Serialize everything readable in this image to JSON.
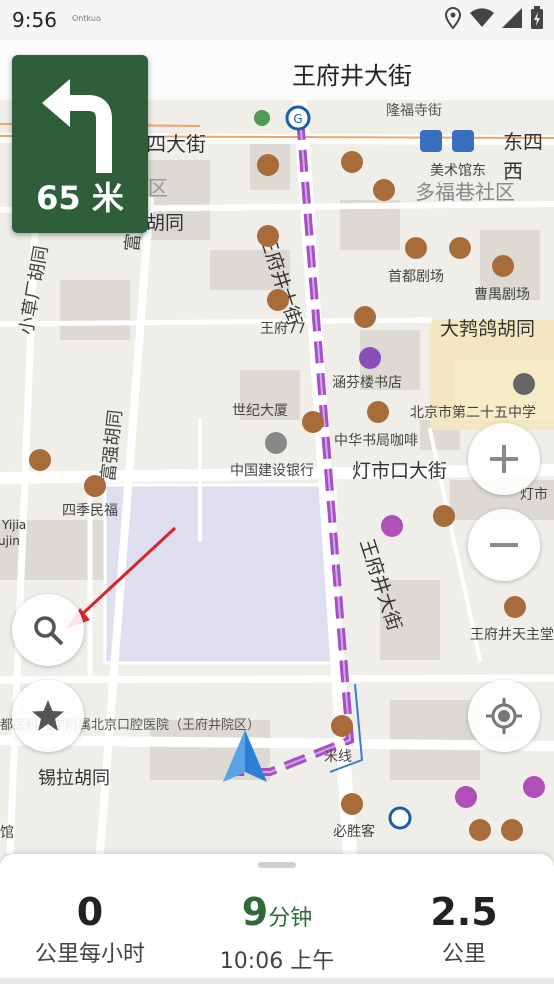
{
  "status_bar": {
    "time": "9:56",
    "tiny_label": "Ontkuo"
  },
  "header": {
    "current_street": "王府井大街"
  },
  "maneuver": {
    "distance": "65 米"
  },
  "map": {
    "streets": {
      "dongsi_west": "四大街",
      "dongsi_east": "东四西",
      "wangfujing_north": "王府井大街",
      "wangfujing_south": "王府井大街",
      "dengshikou": "灯市口大街",
      "fuqiang": "富强胡同",
      "fuqiang2": "富强胡同",
      "xiaoqiao": "小草厂胡同",
      "hutong": "胡同",
      "xila": "锡拉胡同",
      "dapu": "大鹁鸽胡同",
      "district": "区",
      "duofu": "多福巷社区",
      "yijia": "Yijia",
      "jin": "ujin"
    },
    "pois": {
      "longfu": "隆福寺街",
      "meishu": "美术馆东",
      "shoudu": "首都剧场",
      "caoyu": "曹禺剧场",
      "wangfu77": "王府77",
      "hanfen": "涵芬楼书店",
      "zhonghua": "中华书局咖啡",
      "shijida": "世纪大厦",
      "jianshe": "中国建设银行",
      "sijimin": "四季民福",
      "school25": "北京市第二十五中学",
      "church": "王府井天主堂",
      "hospital": "都医科大学附属北京口腔医院（王府井院区）",
      "mixian": "米线",
      "bisheng": "必胜客",
      "dengshi_right": "灯市",
      "guan": "馆"
    }
  },
  "bottom_panel": {
    "speed_value": "0",
    "speed_unit": "公里每小时",
    "eta_minutes": "9",
    "eta_unit": "分钟",
    "arrival_time": "10:06 上午",
    "distance_value": "2.5",
    "distance_unit": "公里"
  },
  "colors": {
    "route": "#a64fc6",
    "maneuver_bg": "#2f5e3b",
    "eta": "#2e6b39",
    "arrow": "#d9252a"
  }
}
